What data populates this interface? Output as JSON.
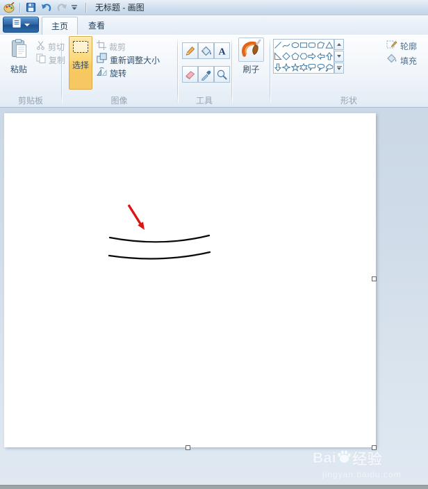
{
  "window": {
    "title": "无标题 - 画图",
    "quick_access_icons": [
      "paint-app-icon",
      "save-icon",
      "undo-icon",
      "redo-icon",
      "customize-quick-access-icon"
    ],
    "tabs": [
      {
        "label": "主页",
        "active": true
      },
      {
        "label": "查看",
        "active": false
      }
    ]
  },
  "ribbon": {
    "clipboard": {
      "label": "剪贴板",
      "paste": "粘贴",
      "cut": "剪切",
      "copy": "复制"
    },
    "image": {
      "label": "图像",
      "select": "选择",
      "crop": "裁剪",
      "resize": "重新调整大小",
      "rotate": "旋转"
    },
    "tools": {
      "label": "工具",
      "icons": [
        "pencil-icon",
        "fill-with-color-icon",
        "text-tool-icon",
        "eraser-icon",
        "color-picker-icon",
        "magnifier-icon"
      ]
    },
    "brushes": {
      "label": "刷子"
    },
    "shapes": {
      "label": "形状",
      "outline": "轮廓",
      "fill": "填充",
      "icons": [
        "line",
        "curve",
        "ellipse",
        "rectangle",
        "rounded-rectangle",
        "polygon",
        "triangle",
        "right-triangle",
        "diamond",
        "pentagon",
        "hexagon",
        "right-arrow",
        "left-arrow",
        "up-arrow",
        "down-arrow",
        "four-point-star",
        "five-point-star",
        "six-point-star",
        "rounded-rectangle-callout",
        "oval-callout",
        "cloud-callout"
      ]
    }
  },
  "canvas": {
    "contents": [
      "black-curved-line",
      "black-curved-line",
      "red-annotation-arrow"
    ]
  },
  "watermark": {
    "brand_latin": "Bai",
    "brand_cjk": "经验",
    "url": "jingyan.baidu.com"
  }
}
